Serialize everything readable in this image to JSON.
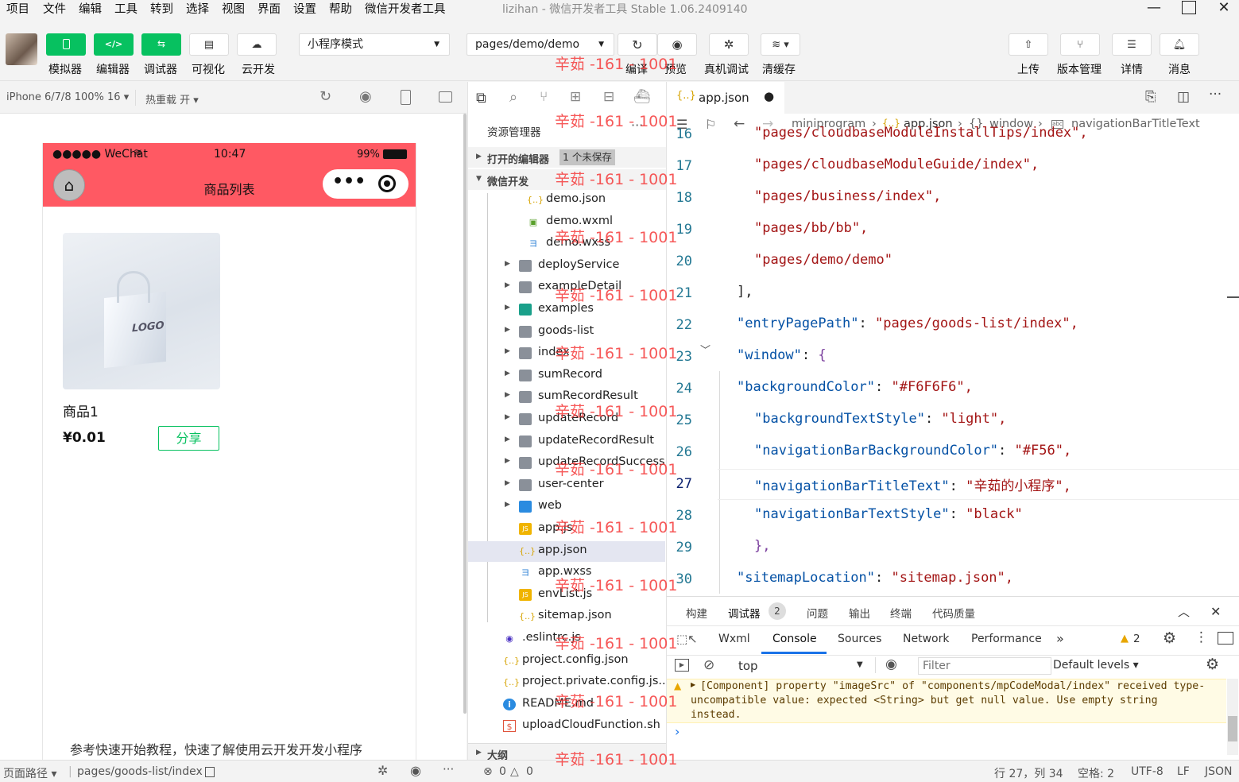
{
  "menubar": {
    "items": [
      "项目",
      "文件",
      "编辑",
      "工具",
      "转到",
      "选择",
      "视图",
      "界面",
      "设置",
      "帮助",
      "微信开发者工具"
    ],
    "window_title": "lizihan - 微信开发者工具 Stable 1.06.2409140"
  },
  "toolbar": {
    "simulator": "模拟器",
    "editor": "编辑器",
    "debugger": "调试器",
    "visualize": "可视化",
    "cloud": "云开发",
    "mode": "小程序模式",
    "page": "pages/demo/demo",
    "compile": "编译",
    "preview": "预览",
    "real_debug": "真机调试",
    "clear_cache": "清缓存",
    "upload": "上传",
    "version": "版本管理",
    "details": "详情",
    "messages": "消息"
  },
  "simbar": {
    "device": "iPhone 6/7/8 100% 16",
    "hot_reload": "热重载 开"
  },
  "phone": {
    "carrier": "●●●●● WeChat",
    "time": "10:47",
    "battery": "99%",
    "nav_title": "商品列表",
    "product_name": "商品1",
    "price": "¥0.01",
    "share_button": "分享",
    "logo_text": "LOGO",
    "footer_text": "参考快速开始教程，快速了解使用云开发开发小程序"
  },
  "explorer": {
    "title": "资源管理器",
    "open_editors": "打开的编辑器",
    "unsaved_badge": "1 个未保存",
    "project": "微信开发",
    "outline": "大纲",
    "items": [
      {
        "name": "demo.json",
        "type": "json"
      },
      {
        "name": "demo.wxml",
        "type": "wxml"
      },
      {
        "name": "demo.wxss",
        "type": "wxss"
      },
      {
        "name": "deployService",
        "type": "folder"
      },
      {
        "name": "exampleDetail",
        "type": "folder"
      },
      {
        "name": "examples",
        "type": "folder"
      },
      {
        "name": "goods-list",
        "type": "folder"
      },
      {
        "name": "index",
        "type": "folder"
      },
      {
        "name": "sumRecord",
        "type": "folder"
      },
      {
        "name": "sumRecordResult",
        "type": "folder"
      },
      {
        "name": "updateRecord",
        "type": "folder"
      },
      {
        "name": "updateRecordResult",
        "type": "folder"
      },
      {
        "name": "updateRecordSuccess",
        "type": "folder"
      },
      {
        "name": "user-center",
        "type": "folder"
      },
      {
        "name": "web",
        "type": "folder"
      },
      {
        "name": "app.js",
        "type": "js"
      },
      {
        "name": "app.json",
        "type": "json"
      },
      {
        "name": "app.wxss",
        "type": "wxss"
      },
      {
        "name": "envList.js",
        "type": "js"
      },
      {
        "name": "sitemap.json",
        "type": "json"
      },
      {
        "name": ".eslintrc.js",
        "type": "eslint"
      },
      {
        "name": "project.config.json",
        "type": "json"
      },
      {
        "name": "project.private.config.js...",
        "type": "json"
      },
      {
        "name": "README.md",
        "type": "info"
      },
      {
        "name": "uploadCloudFunction.sh",
        "type": "sh"
      }
    ]
  },
  "editor": {
    "tab": "app.json",
    "breadcrumb": [
      "miniprogram",
      "app.json",
      "window",
      "navigationBarTitleText"
    ],
    "lines": [
      {
        "n": "16",
        "text": "\"pages/cloudbaseModuleInstallTips/index\","
      },
      {
        "n": "17",
        "text": "\"pages/cloudbaseModuleGuide/index\","
      },
      {
        "n": "18",
        "text": "\"pages/business/index\","
      },
      {
        "n": "19",
        "text": "\"pages/bb/bb\","
      },
      {
        "n": "20",
        "text": "\"pages/demo/demo\""
      },
      {
        "n": "21",
        "text": "],"
      },
      {
        "n": "22",
        "key": "\"entryPagePath\"",
        "value": "\"pages/goods-list/index\","
      },
      {
        "n": "23",
        "key": "\"window\"",
        "value": "{"
      },
      {
        "n": "24",
        "key": "\"backgroundColor\"",
        "value": "\"#F6F6F6\","
      },
      {
        "n": "25",
        "key": "\"backgroundTextStyle\"",
        "value": "\"light\","
      },
      {
        "n": "26",
        "key": "\"navigationBarBackgroundColor\"",
        "value": "\"#F56\","
      },
      {
        "n": "27",
        "key": "\"navigationBarTitleText\"",
        "value": "\"辛茹的小程序\","
      },
      {
        "n": "28",
        "key": "\"navigationBarTextStyle\"",
        "value": "\"black\""
      },
      {
        "n": "29",
        "text": "},"
      },
      {
        "n": "30",
        "key": "\"sitemapLocation\"",
        "value": "\"sitemap.json\","
      }
    ]
  },
  "debugger": {
    "tabs": [
      "构建",
      "调试器",
      "问题",
      "输出",
      "终端",
      "代码质量"
    ],
    "debugger_badge": "2",
    "console_tabs": [
      "Wxml",
      "Console",
      "Sources",
      "Network",
      "Performance"
    ],
    "warning_count": "2",
    "context": "top",
    "filter_placeholder": "Filter",
    "levels": "Default levels",
    "warning_message": "[Component] property \"imageSrc\" of \"components/mpCodeModal/index\" received type-uncompatible value: expected <String> but get null value. Use empty string instead.",
    "prompt": "›"
  },
  "statusbar": {
    "page_path_label": "页面路径",
    "page_path": "pages/goods-list/index",
    "errors": "0",
    "warnings": "0",
    "cursor": "行 27，列 34",
    "spaces": "空格: 2",
    "encoding": "UTF-8",
    "eol": "LF",
    "language": "JSON"
  },
  "watermark": "辛茹 -161 - 1001",
  "colors": {
    "accent": "#07c160",
    "nav_bar": "#ff5963",
    "json_key": "#0451a5",
    "json_string": "#a31515"
  }
}
